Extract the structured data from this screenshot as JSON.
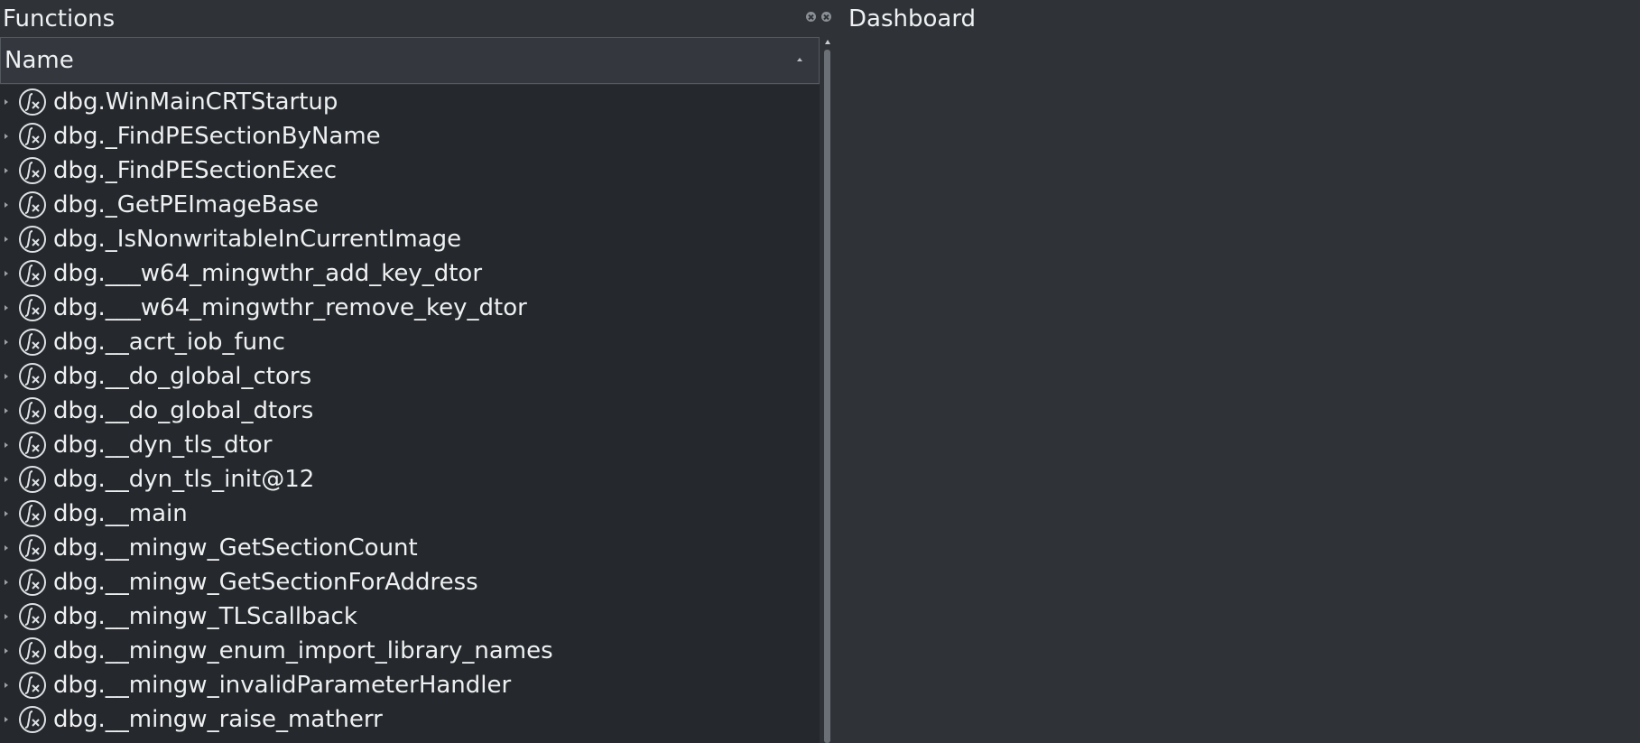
{
  "functions_panel": {
    "title": "Functions",
    "column_header": "Name",
    "items": [
      {
        "name": "dbg.WinMainCRTStartup"
      },
      {
        "name": "dbg._FindPESectionByName"
      },
      {
        "name": "dbg._FindPESectionExec"
      },
      {
        "name": "dbg._GetPEImageBase"
      },
      {
        "name": "dbg._IsNonwritableInCurrentImage"
      },
      {
        "name": "dbg.___w64_mingwthr_add_key_dtor"
      },
      {
        "name": "dbg.___w64_mingwthr_remove_key_dtor"
      },
      {
        "name": "dbg.__acrt_iob_func"
      },
      {
        "name": "dbg.__do_global_ctors"
      },
      {
        "name": "dbg.__do_global_dtors"
      },
      {
        "name": "dbg.__dyn_tls_dtor"
      },
      {
        "name": "dbg.__dyn_tls_init@12"
      },
      {
        "name": "dbg.__main"
      },
      {
        "name": "dbg.__mingw_GetSectionCount"
      },
      {
        "name": "dbg.__mingw_GetSectionForAddress"
      },
      {
        "name": "dbg.__mingw_TLScallback"
      },
      {
        "name": "dbg.__mingw_enum_import_library_names"
      },
      {
        "name": "dbg.__mingw_invalidParameterHandler"
      },
      {
        "name": "dbg.__mingw_raise_matherr"
      }
    ]
  },
  "dashboard_panel": {
    "title": "Dashboard"
  },
  "colors": {
    "panel_bg": "#2f3338",
    "list_bg": "#25282c",
    "text": "#eef0f2",
    "border": "#54595f"
  },
  "icons": {
    "function": "function-icon",
    "expand": "expand-arrow-icon"
  }
}
